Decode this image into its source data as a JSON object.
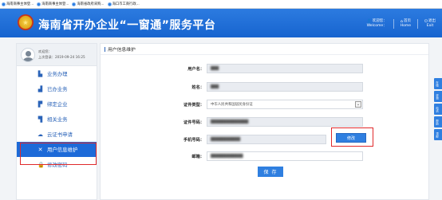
{
  "bookmarks": [
    {
      "label": "海南商事主体登..."
    },
    {
      "label": "海南商事主体登..."
    },
    {
      "label": "海南省政府采购..."
    },
    {
      "label": "海口市工商行政..."
    }
  ],
  "header": {
    "title": "海南省开办企业“一窗通”服务平台",
    "links": [
      {
        "icon": "user-icon",
        "top": "欢迎您：",
        "bottom": "Welcome："
      },
      {
        "icon": "home-icon",
        "top": "首页",
        "bottom": "Home"
      },
      {
        "icon": "power-icon",
        "top": "退出",
        "bottom": "Exit"
      }
    ]
  },
  "sidebar": {
    "welcome": "欢迎您：",
    "last_login": "上次登录：2019-09-24 16:25",
    "items": [
      {
        "icon": "briefcase-icon",
        "label": "业务办理",
        "active": false
      },
      {
        "icon": "done-icon",
        "label": "已办业务",
        "active": false
      },
      {
        "icon": "bind-icon",
        "label": "绑定企业",
        "active": false
      },
      {
        "icon": "related-icon",
        "label": "相关业务",
        "active": false
      },
      {
        "icon": "certificate-icon",
        "label": "云证书申请",
        "active": false
      },
      {
        "icon": "tools-icon",
        "label": "用户信息维护",
        "active": true
      },
      {
        "icon": "lock-icon",
        "label": "修改密码",
        "active": false
      }
    ]
  },
  "main": {
    "title": "用户信息维护",
    "fields": {
      "username": {
        "label": "用户名：",
        "value": "███"
      },
      "name": {
        "label": "姓名：",
        "value": "███"
      },
      "id_type": {
        "label": "证件类型：",
        "value": "中华人民共和国居民身份证"
      },
      "id_number": {
        "label": "证件号码：",
        "value": "██████████████"
      },
      "phone": {
        "label": "手机号码：",
        "value": "███████████"
      },
      "email": {
        "label": "邮箱：",
        "value": "████████████"
      }
    },
    "edit_label": "修改",
    "save_label": "保 存"
  },
  "float_tabs": [
    "在线",
    "咨询",
    "电话",
    "帮助",
    "顶部"
  ]
}
